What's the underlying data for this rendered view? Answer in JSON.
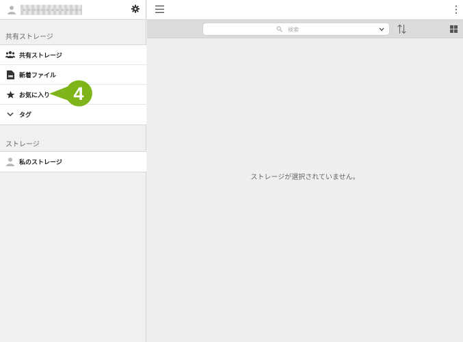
{
  "sidebar": {
    "shared_section_title": "共有ストレージ",
    "shared_items": [
      {
        "label": "共有ストレージ",
        "icon": "users-icon"
      },
      {
        "label": "新着ファイル",
        "icon": "new-file-icon"
      },
      {
        "label": "お気に入り",
        "icon": "star-icon"
      },
      {
        "label": "タグ",
        "icon": "chevron-down-icon"
      }
    ],
    "storage_section_title": "ストレージ",
    "storage_items": [
      {
        "label": "私のストレージ",
        "icon": "user-icon"
      }
    ]
  },
  "callout": {
    "number": "4",
    "color": "#7fb51a"
  },
  "toolbar": {
    "search_placeholder": "検索"
  },
  "main": {
    "empty_message": "ストレージが選択されていません。"
  }
}
